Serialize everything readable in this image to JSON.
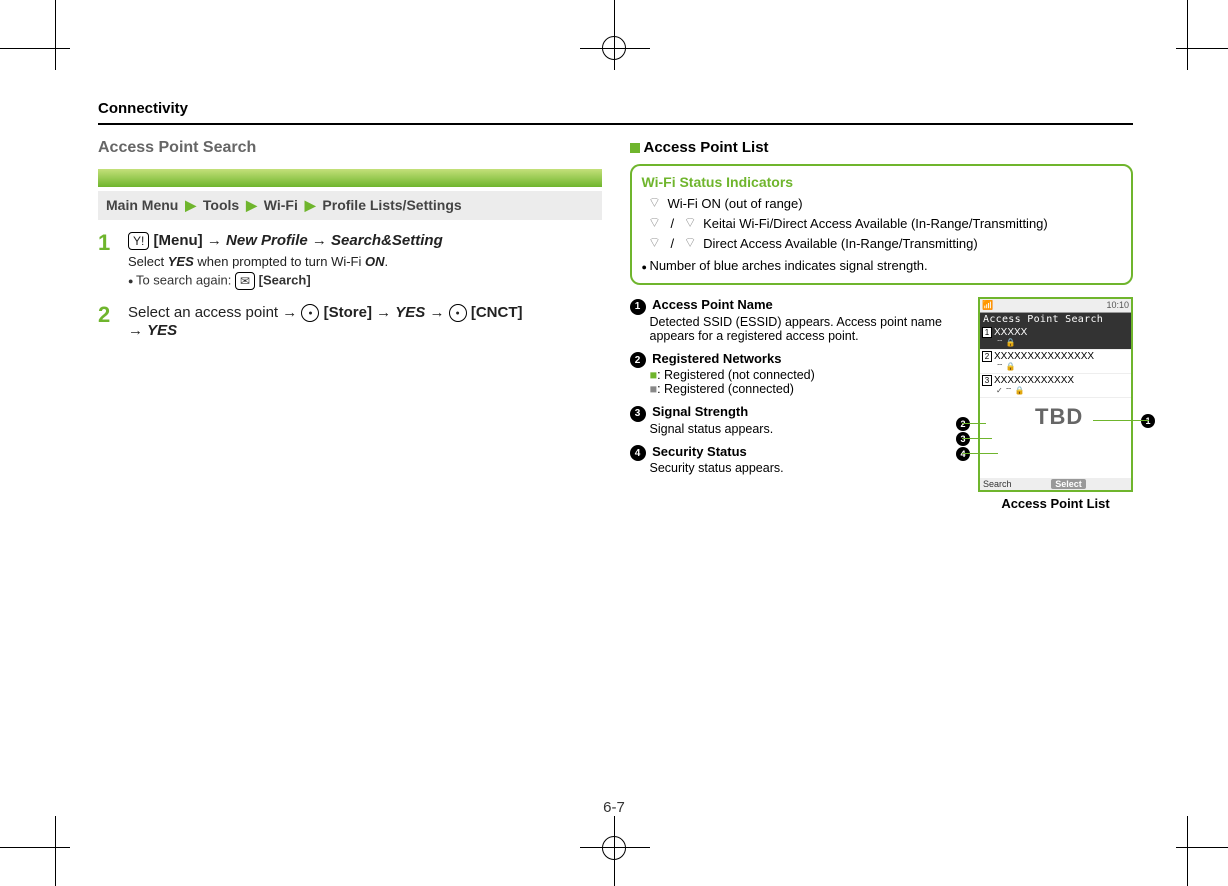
{
  "header": "Connectivity",
  "left": {
    "title": "Access Point Search",
    "path": {
      "root": "Main Menu",
      "p1": "Tools",
      "p2": "Wi-Fi",
      "p3": "Profile Lists/Settings"
    },
    "step1": {
      "num": "1",
      "menu_key": "Y!",
      "menu_label": "[Menu]",
      "arrow": "→",
      "np": "New Profile",
      "ss": "Search&Setting",
      "note1a": "Select ",
      "yes": "YES",
      "note1b": " when prompted to turn Wi-Fi ",
      "on": "ON",
      "note1c": ".",
      "note2a": "To search again: ",
      "mail_key": "✉",
      "search_label": "[Search]"
    },
    "step2": {
      "num": "2",
      "a": "Select an access point",
      "arrow": "→",
      "store": "[Store]",
      "yes": "YES",
      "cnct": "[CNCT]"
    }
  },
  "right": {
    "title": "Access Point List",
    "wifi_box": {
      "title": "Wi-Fi Status Indicators",
      "row1": "Wi-Fi ON (out of range)",
      "row2": "Keitai Wi-Fi/Direct Access Available (In-Range/Transmitting)",
      "row3": "Direct Access Available (In-Range/Transmitting)",
      "note": "Number of blue arches indicates signal strength."
    },
    "legend": {
      "i1": {
        "n": "❶",
        "lbl": "Access Point Name",
        "desc": "Detected SSID (ESSID) appears. Access point name appears for a registered access point."
      },
      "i2": {
        "n": "❷",
        "lbl": "Registered Networks",
        "desc1": ": Registered (not connected)",
        "desc2": ": Registered (connected)"
      },
      "i3": {
        "n": "❸",
        "lbl": "Signal Strength",
        "desc": "Signal status appears."
      },
      "i4": {
        "n": "❹",
        "lbl": "Security Status",
        "desc": "Security status appears."
      }
    },
    "phone": {
      "time": "10:10",
      "title": "Access Point Search",
      "item1": "XXXXX",
      "item2": "XXXXXXXXXXXXXXX",
      "item3": "XXXXXXXXXXXX",
      "sk_left": "Search",
      "sk_mid": "Select",
      "tbd": "TBD",
      "caption": "Access Point List"
    }
  },
  "page_num": "6-7"
}
